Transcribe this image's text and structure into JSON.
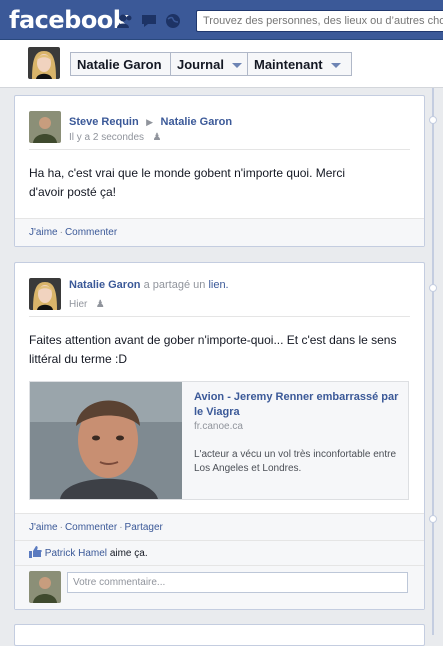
{
  "header": {
    "logo": "facebook",
    "search_placeholder": "Trouvez des personnes, des lieux ou d’autres chose"
  },
  "timeline_nav": {
    "name": "Natalie Garon",
    "journal": "Journal",
    "maintenant": "Maintenant"
  },
  "post1": {
    "author": "Steve Requin",
    "target": "Natalie Garon",
    "time": "Il y a 2 secondes",
    "text": "Ha ha, c'est vrai que le monde gobent n'importe quoi. Merci d'avoir posté ça!",
    "like": "J'aime",
    "comment": "Commenter"
  },
  "post2": {
    "author": "Natalie Garon",
    "shared": "a partagé un",
    "shared_link": "lien.",
    "time": "Hier",
    "text": "Faites attention avant de gober n'importe-quoi... Et c'est dans le sens littéral du terme :D",
    "link_title": "Avion - Jeremy Renner embarrassé par le Viagra",
    "link_domain": "fr.canoe.ca",
    "link_desc": "L'acteur a vécu un vol très inconfortable entre Los Angeles et Londres.",
    "like": "J'aime",
    "comment": "Commenter",
    "share": "Partager",
    "liker": "Patrick Hamel",
    "likes_text": "aime ça.",
    "comment_placeholder": "Votre commentaire..."
  }
}
